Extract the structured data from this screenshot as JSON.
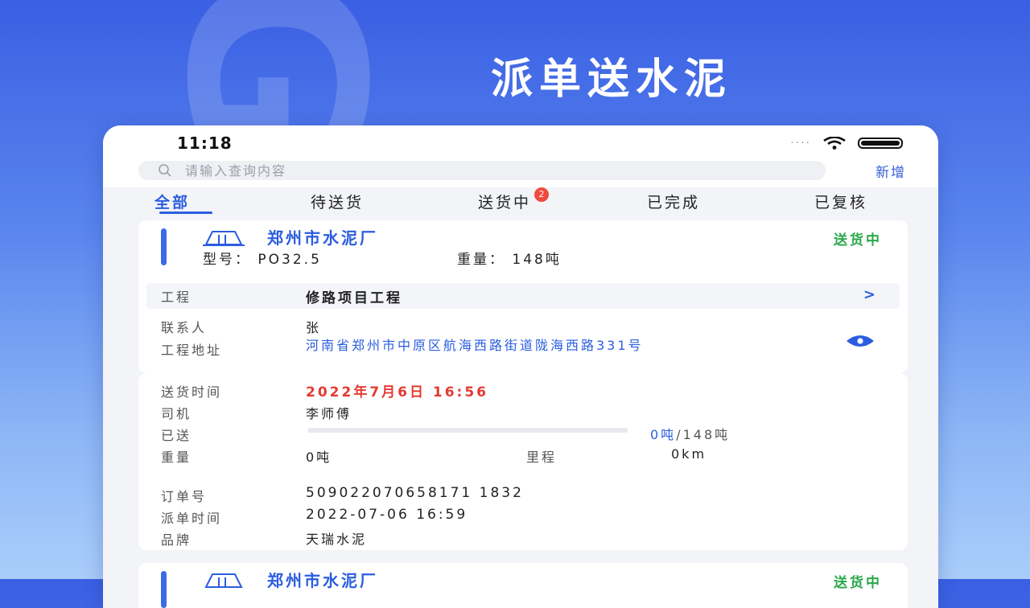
{
  "background": {
    "letters": "GUI"
  },
  "headline": "派单送水泥",
  "status_bar": {
    "time": "11:18",
    "signal": "····"
  },
  "search": {
    "placeholder": "请输入查询内容",
    "add_label": "新增"
  },
  "tabs": [
    {
      "label": "全部",
      "active": true
    },
    {
      "label": "待送货"
    },
    {
      "label": "送货中",
      "badge": "2"
    },
    {
      "label": "已完成"
    },
    {
      "label": "已复核"
    }
  ],
  "order": {
    "factory": "郑州市水泥厂",
    "status": "送货中",
    "model_label": "型号：",
    "model_value": "PO32.5",
    "weight_label": "重量：",
    "weight_value": "148吨",
    "project_label": "工程",
    "project_value": "修路项目工程",
    "project_chevron": ">",
    "contact_label": "联系人",
    "contact_value": "张",
    "address_label": "工程地址",
    "address_value": "河南省郑州市中原区航海西路街道陇海西路331号",
    "delivery_time_label": "送货时间",
    "delivery_time_value": "2022年7月6日 16:56",
    "driver_label": "司机",
    "driver_value": "李师傅",
    "sent_label": "已送",
    "sent_done": "0吨",
    "sent_total": "/148吨",
    "sent_progress": 0,
    "weight2_label": "重量",
    "weight2_value": "0吨",
    "mileage_label": "里程",
    "mileage_value": "0km",
    "order_no_label": "订单号",
    "order_no_value": "509022070658171 1832",
    "dispatch_time_label": "派单时间",
    "dispatch_time_value": "2022-07-06 16:59",
    "brand_label": "品牌",
    "brand_value": "天瑞水泥"
  },
  "next_order": {
    "factory": "郑州市水泥厂",
    "status": "送货中"
  },
  "colors": {
    "accent": "#2b5de0",
    "status_green": "#2aa84a",
    "time_red": "#e53a32"
  }
}
